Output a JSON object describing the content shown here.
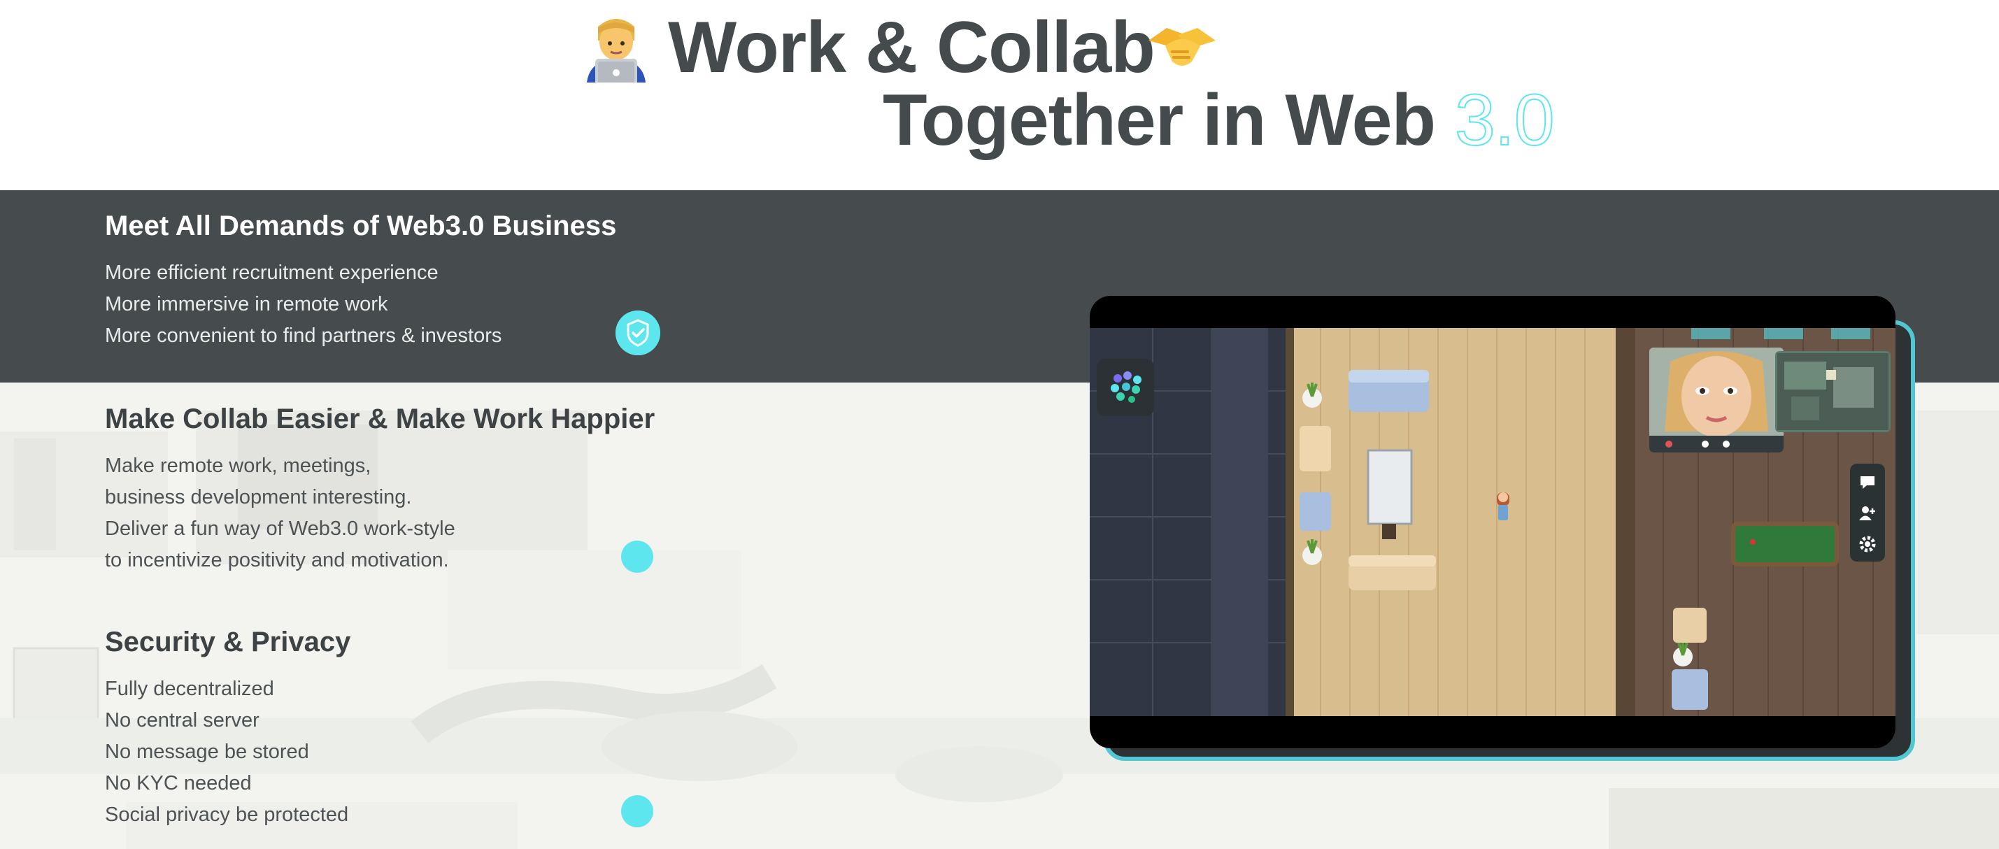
{
  "hero": {
    "line1": "Work & Collab",
    "line2_prefix": "Together in Web",
    "line2_outline": "3.0",
    "emoji_left": "technologist-icon",
    "emoji_right": "handshake-icon"
  },
  "features": [
    {
      "title": "Meet All Demands of Web3.0 Business",
      "lines": [
        "More efficient recruitment experience",
        "More immersive in remote work",
        "More convenient to find partners & investors"
      ],
      "active": true
    },
    {
      "title": "Make Collab Easier & Make Work Happier",
      "lines": [
        "Make remote work, meetings,",
        "business development interesting.",
        "Deliver a fun way of Web3.0 work-style",
        "to incentivize positivity and motivation."
      ],
      "active": false
    },
    {
      "title": "Security & Privacy",
      "lines": [
        "Fully decentralized",
        "No central server",
        "No message be stored",
        "No KYC needed",
        "Social privacy be protected"
      ],
      "active": false
    }
  ],
  "game": {
    "tools": [
      "chat-icon",
      "add-user-icon",
      "settings-icon"
    ]
  },
  "colors": {
    "accent": "#5de6ee",
    "dark_band": "#464c4d",
    "heading": "#454a4c"
  }
}
